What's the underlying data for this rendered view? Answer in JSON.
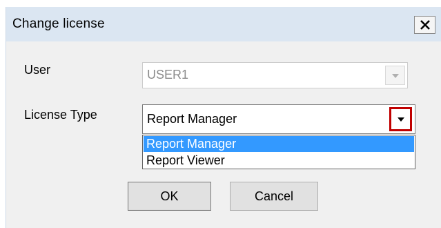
{
  "dialog": {
    "title": "Change license",
    "close_glyph": "✕",
    "close_icon": "close-icon"
  },
  "form": {
    "user_label": "User",
    "user_value": "USER1",
    "user_enabled": false,
    "license_label": "License Type",
    "license_value": "Report Manager",
    "license_dropdown_open": true,
    "license_options": [
      "Report Manager",
      "Report Viewer"
    ],
    "license_selected_index": 0
  },
  "buttons": {
    "ok_label": "OK",
    "cancel_label": "Cancel"
  },
  "colors": {
    "titlebar": "#dbe6f2",
    "dialog_bg": "#f0f0f0",
    "selection": "#3399ff",
    "highlight_box": "#c00000",
    "disabled_text": "#8c8c8c"
  }
}
